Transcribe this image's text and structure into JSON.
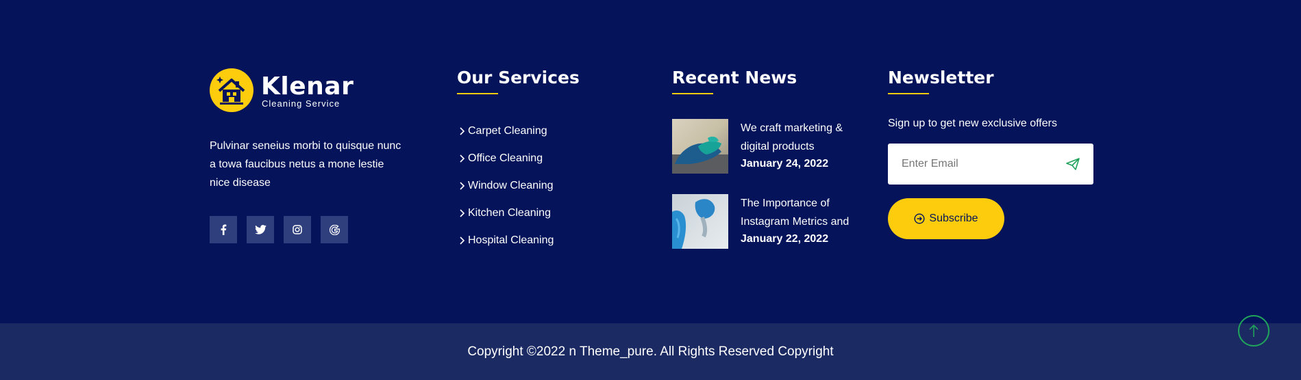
{
  "brand": {
    "name": "Klenar",
    "tagline": "Cleaning Service",
    "about": "Pulvinar seneius morbi to quisque nunc a towa faucibus netus a mone lestie nice disease",
    "socials": [
      {
        "icon": "facebook-icon",
        "glyph": "f"
      },
      {
        "icon": "twitter-icon",
        "glyph": "t"
      },
      {
        "icon": "instagram-icon",
        "glyph": "ig"
      },
      {
        "icon": "google-icon",
        "glyph": "G"
      }
    ]
  },
  "services": {
    "title": "Our Services",
    "items": [
      "Carpet Cleaning",
      "Office Cleaning",
      "Window Cleaning",
      "Kitchen Cleaning",
      "Hospital Cleaning"
    ]
  },
  "news": {
    "title": "Recent News",
    "items": [
      {
        "title": "We craft marketing & digital products",
        "date": "January 24, 2022"
      },
      {
        "title": "The Importance of Instagram Metrics and",
        "date": "January 22, 2022"
      }
    ]
  },
  "newsletter": {
    "title": "Newsletter",
    "text": "Sign up to get new exclusive offers",
    "placeholder": "Enter Email",
    "button": "Subscribe"
  },
  "footer": {
    "copyright": "Copyright ©2022 n Theme_pure. All Rights Reserved Copyright"
  },
  "colors": {
    "background": "#04135a",
    "bottom_bar": "#1b2a63",
    "accent": "#fdcc0d",
    "back_to_top": "#1fa35b"
  }
}
